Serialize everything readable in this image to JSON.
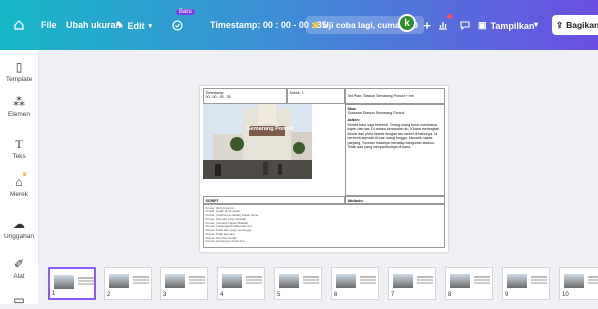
{
  "topbar": {
    "file_label": "File",
    "resize_label": "Ubah ukuran",
    "edit_label": "Edit",
    "new_badge": "Baru",
    "timestamp": "Timestamp: 00 : 00 - 00 : 35",
    "promo": "Uji coba lagi, cuma Rp0",
    "avatar_initial": "k",
    "present_label": "Tampilkan",
    "share_label": "Bagikan"
  },
  "sidebar": {
    "items": [
      {
        "label": "Template",
        "icon": "template-icon"
      },
      {
        "label": "Elemen",
        "icon": "elements-icon"
      },
      {
        "label": "Teks",
        "icon": "text-icon"
      },
      {
        "label": "Merek",
        "icon": "brand-icon"
      },
      {
        "label": "Unggahan",
        "icon": "upload-icon"
      },
      {
        "label": "Alat",
        "icon": "tools-icon"
      }
    ]
  },
  "document": {
    "timestamp_label": "Timestamp:",
    "timestamp_value": "00 : 00 - 00 : 35",
    "scene_label": "Scene: 1",
    "set_label": "Set Plan: Stasiun Semarang Poncol + ext.",
    "shot_label": "Shot:",
    "shot_value": "Suasana Stasiun Semarang Poncol",
    "action_label": "Action:",
    "action_value": "Kereta baru saja berhenti. Orang-orang turun membawa koper dan tas. Di antara keramaian itu, Kirana melangkah keluar dari pintu kereta dengan tas ransel di bahunya. Ia berhenti sejenak di luar ruang tunggu. Menarik napas panjang. Sorotan matanya menatap bangunan stasiun. Tidak ada yang menyambutnya di sana.",
    "sign_text": "Semarang Poncol",
    "script_label": "SCRIPT",
    "attribute_label": "Attribute:",
    "script_lines": [
      "Kirana: (lirih) Kota ini...",
      "Kirana: sudah lama sekali.",
      "Kirana: (melihat ke sekitar) Masih sama.",
      "Kirana: Tapi aku yang berubah.",
      "Kirana: (menarik napas) Baiklah.",
      "Kirana: (melangkah) Mulai dari sini.",
      "Kirana: Tidak ada yang menunggu.",
      "Kirana: Tidak apa-apa.",
      "Kirana: Aku bisa sendiri.",
      "Kirana: (tersenyum kecil) Ayo."
    ]
  },
  "filmstrip": {
    "pages": [
      "1",
      "2",
      "3",
      "4",
      "5",
      "6",
      "7",
      "8",
      "9",
      "10"
    ]
  }
}
